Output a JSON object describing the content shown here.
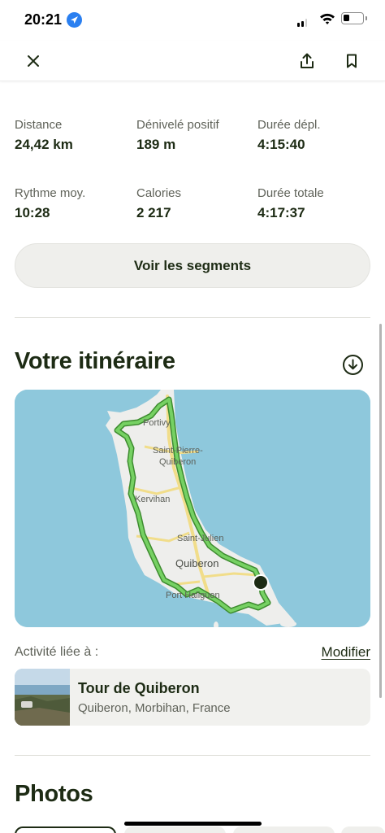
{
  "status_bar": {
    "time": "20:21",
    "icons": [
      "location-arrow-icon",
      "signal-icon",
      "wifi-icon",
      "battery-icon"
    ]
  },
  "top_bar": {
    "icons": [
      "close-icon",
      "share-icon",
      "bookmark-icon"
    ]
  },
  "stats": [
    {
      "label": "Distance",
      "value": "24,42 km"
    },
    {
      "label": "Dénivelé positif",
      "value": "189 m"
    },
    {
      "label": "Durée dépl.",
      "value": "4:15:40"
    },
    {
      "label": "Rythme moy.",
      "value": "10:28"
    },
    {
      "label": "Calories",
      "value": "2 217"
    },
    {
      "label": "Durée totale",
      "value": "4:17:37"
    }
  ],
  "segments_button": "Voir les segments",
  "itinerary": {
    "title": "Votre itinéraire",
    "download_icon": "download-icon",
    "map": {
      "labels": [
        "Portivy",
        "Saint-Pierre-",
        "Quiberon",
        "Kervihan",
        "Saint-Julien",
        "Quiberon",
        "Port Haliguen"
      ],
      "colors": {
        "water": "#8ec8dc",
        "land": "#eeeeec",
        "route": "#6ecb5e",
        "road": "#f1dd8a"
      }
    }
  },
  "linked_activity": {
    "label": "Activité liée à :",
    "modify": "Modifier",
    "title": "Tour de Quiberon",
    "subtitle": "Quiberon, Morbihan, France"
  },
  "photos": {
    "title": "Photos"
  }
}
